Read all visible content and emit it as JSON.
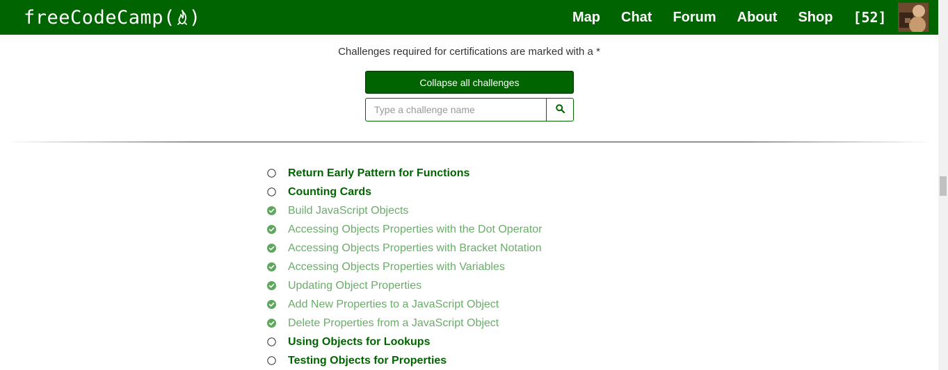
{
  "navbar": {
    "brand_left": "freeCodeCamp(",
    "brand_right": ")",
    "links": [
      "Map",
      "Chat",
      "Forum",
      "About",
      "Shop"
    ],
    "points": "[52]",
    "icons": {
      "flame": "fire-icon",
      "avatar": "user-avatar"
    }
  },
  "page": {
    "subtitle": "Challenges required for certifications are marked with a *",
    "collapse_label": "Collapse all challenges",
    "search_placeholder": "Type a challenge name",
    "search_icon": "search-icon"
  },
  "challenges": [
    {
      "title": "Return Early Pattern for Functions",
      "completed": false
    },
    {
      "title": "Counting Cards",
      "completed": false
    },
    {
      "title": "Build JavaScript Objects",
      "completed": true
    },
    {
      "title": "Accessing Objects Properties with the Dot Operator",
      "completed": true
    },
    {
      "title": "Accessing Objects Properties with Bracket Notation",
      "completed": true
    },
    {
      "title": "Accessing Objects Properties with Variables",
      "completed": true
    },
    {
      "title": "Updating Object Properties",
      "completed": true
    },
    {
      "title": "Add New Properties to a JavaScript Object",
      "completed": true
    },
    {
      "title": "Delete Properties from a JavaScript Object",
      "completed": true
    },
    {
      "title": "Using Objects for Lookups",
      "completed": false
    },
    {
      "title": "Testing Objects for Properties",
      "completed": false
    }
  ],
  "colors": {
    "brand_green": "#006400",
    "completed_text": "#6bac6b",
    "completed_check": "#5fa65f"
  }
}
